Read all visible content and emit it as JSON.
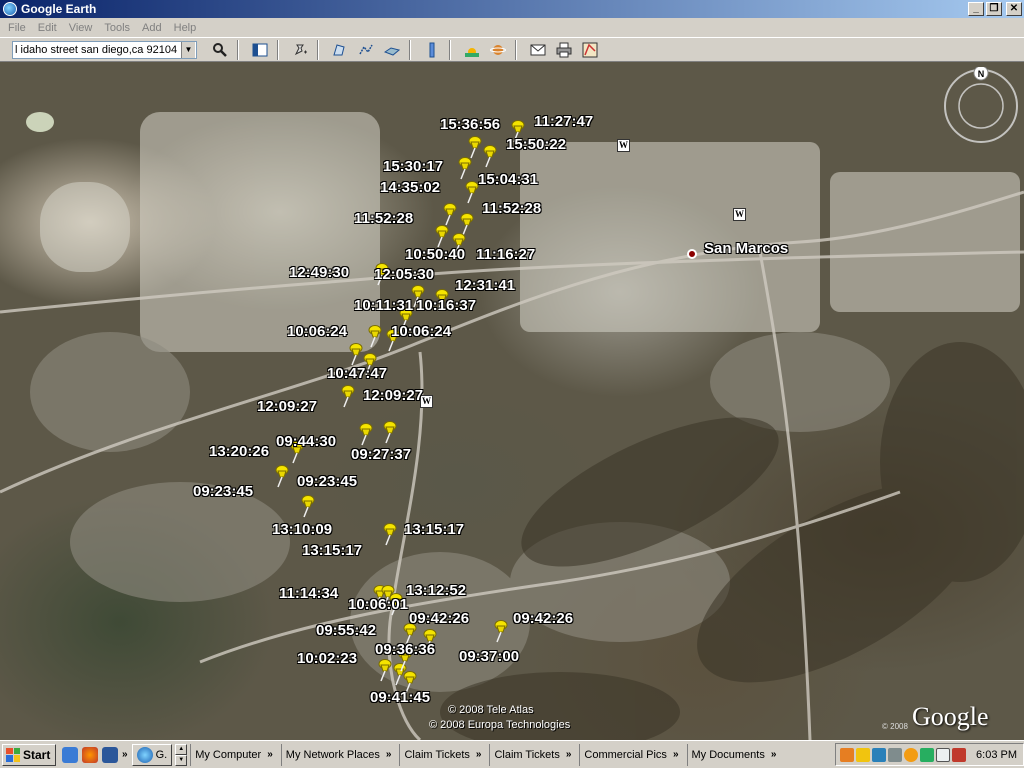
{
  "window": {
    "title": "Google Earth",
    "controls": [
      "_",
      "❐",
      "✕"
    ]
  },
  "menu": [
    "File",
    "Edit",
    "View",
    "Tools",
    "Add",
    "Help"
  ],
  "toolbar": {
    "search_value": "l idaho street san diego,ca 92104",
    "buttons": [
      "search-icon",
      "sidebar-icon",
      "placemark-icon",
      "polygon-icon",
      "path-icon",
      "overlay-icon",
      "ruler-icon",
      "sun-icon",
      "planet-icon",
      "email-icon",
      "print-icon",
      "maps-icon"
    ]
  },
  "map": {
    "city": "San Marcos",
    "timestamps": [
      "15:36:56",
      "11:27:47",
      "15:50:22",
      "15:30:17",
      "15:04:31",
      "14:35:02",
      "11:52:28",
      "11:52:28",
      "10:50:40",
      "11:16:27",
      "12:49:30",
      "12:05:30",
      "12:31:41",
      "10:11:31",
      "10:16:37",
      "10:06:24",
      "10:06:24",
      "10:47:47",
      "12:09:27",
      "12:09:27",
      "09:44:30",
      "13:20:26",
      "09:27:37",
      "09:23:45",
      "09:23:45",
      "13:10:09",
      "13:15:17",
      "13:15:17",
      "13:12:52",
      "11:14:34",
      "10:06:01",
      "09:42:26",
      "09:42:26",
      "09:55:42",
      "09:36:36",
      "10:02:23",
      "09:37:00",
      "09:41:45"
    ],
    "credits": [
      "© 2008 Tele Atlas",
      "© 2008 Europa Technologies"
    ],
    "copyright_small": "© 2008",
    "logo": "Google",
    "compass_north": "N"
  },
  "taskbar": {
    "start": "Start",
    "active_app": "G.",
    "links": [
      "My Computer",
      "My Network Places",
      "Claim Tickets",
      "Claim Tickets",
      "Commercial Pics",
      "My Documents"
    ],
    "clock": "6:03 PM"
  }
}
